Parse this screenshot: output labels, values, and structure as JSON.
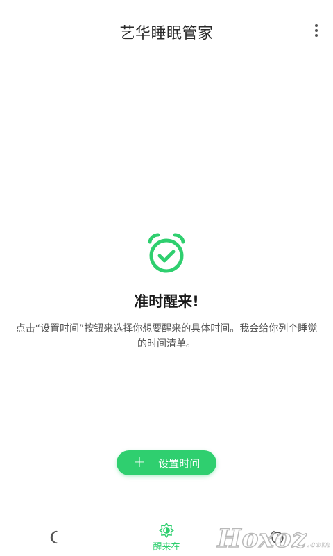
{
  "app": {
    "title": "艺华睡眠管家"
  },
  "empty_state": {
    "icon": "alarm-check-icon",
    "headline": "准时醒来!",
    "description": "点击“设置时间”按钮来选择你想要醒来的具体时间。我会给你列个睡觉的时间清单。"
  },
  "actions": {
    "set_time_label": "设置时间"
  },
  "bottom_nav": {
    "items": [
      {
        "icon": "moon-icon",
        "label": ""
      },
      {
        "icon": "sun-icon",
        "label": "醒来在"
      },
      {
        "icon": "clock-icon",
        "label": ""
      }
    ]
  },
  "watermark": "Hoxoz.com",
  "colors": {
    "accent": "#2fcf6f",
    "title_text": "#2a2a2a",
    "body_text": "#555555"
  }
}
